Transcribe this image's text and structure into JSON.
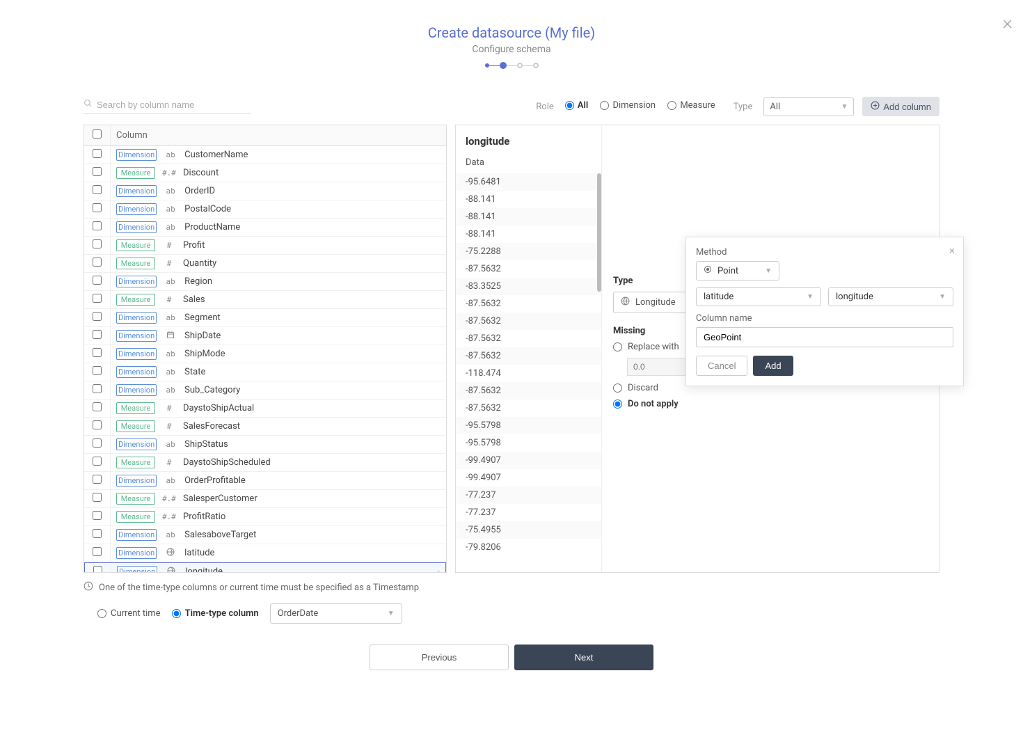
{
  "header": {
    "title": "Create datasource (My file)",
    "subtitle": "Configure schema"
  },
  "toolbar": {
    "search_placeholder": "Search by column name",
    "role_label": "Role",
    "role_options": {
      "all": "All",
      "dimension": "Dimension",
      "measure": "Measure"
    },
    "type_label": "Type",
    "type_value": "All",
    "add_column_label": "Add column"
  },
  "table": {
    "header_label": "Column",
    "columns": [
      {
        "role": "Dimension",
        "type": "ab",
        "name": "CustomerName"
      },
      {
        "role": "Measure",
        "type": "#.#",
        "name": "Discount"
      },
      {
        "role": "Dimension",
        "type": "ab",
        "name": "OrderID"
      },
      {
        "role": "Dimension",
        "type": "ab",
        "name": "PostalCode"
      },
      {
        "role": "Dimension",
        "type": "ab",
        "name": "ProductName"
      },
      {
        "role": "Measure",
        "type": "#",
        "name": "Profit"
      },
      {
        "role": "Measure",
        "type": "#",
        "name": "Quantity"
      },
      {
        "role": "Dimension",
        "type": "ab",
        "name": "Region"
      },
      {
        "role": "Measure",
        "type": "#",
        "name": "Sales"
      },
      {
        "role": "Dimension",
        "type": "ab",
        "name": "Segment"
      },
      {
        "role": "Dimension",
        "type": "cal",
        "name": "ShipDate"
      },
      {
        "role": "Dimension",
        "type": "ab",
        "name": "ShipMode"
      },
      {
        "role": "Dimension",
        "type": "ab",
        "name": "State"
      },
      {
        "role": "Dimension",
        "type": "ab",
        "name": "Sub_Category"
      },
      {
        "role": "Measure",
        "type": "#",
        "name": "DaystoShipActual"
      },
      {
        "role": "Measure",
        "type": "#",
        "name": "SalesForecast"
      },
      {
        "role": "Dimension",
        "type": "ab",
        "name": "ShipStatus"
      },
      {
        "role": "Measure",
        "type": "#",
        "name": "DaystoShipScheduled"
      },
      {
        "role": "Dimension",
        "type": "ab",
        "name": "OrderProfitable"
      },
      {
        "role": "Measure",
        "type": "#.#",
        "name": "SalesperCustomer"
      },
      {
        "role": "Measure",
        "type": "#.#",
        "name": "ProfitRatio"
      },
      {
        "role": "Dimension",
        "type": "ab",
        "name": "SalesaboveTarget"
      },
      {
        "role": "Dimension",
        "type": "geo",
        "name": "latitude"
      },
      {
        "role": "Dimension",
        "type": "geo",
        "name": "longitude",
        "selected": true
      }
    ]
  },
  "detail": {
    "title": "longitude",
    "data_label": "Data",
    "values": [
      "-95.6481",
      "-88.141",
      "-88.141",
      "-88.141",
      "-75.2288",
      "-87.5632",
      "-83.3525",
      "-87.5632",
      "-87.5632",
      "-87.5632",
      "-87.5632",
      "-118.474",
      "-87.5632",
      "-87.5632",
      "-95.5798",
      "-95.5798",
      "-99.4907",
      "-99.4907",
      "-77.237",
      "-77.237",
      "-75.4955",
      "-79.8206"
    ],
    "type_label": "Type",
    "type_value": "Longitude",
    "missing_label": "Missing",
    "missing_options": {
      "replace": "Replace with",
      "replace_placeholder": "0.0",
      "discard": "Discard",
      "donot": "Do not apply"
    }
  },
  "popover": {
    "method_label": "Method",
    "method_value": "Point",
    "field1": "latitude",
    "field2": "longitude",
    "colname_label": "Column name",
    "colname_value": "GeoPoint",
    "cancel": "Cancel",
    "add": "Add"
  },
  "footer": {
    "note": "One of the time-type columns or current time must be specified as a Timestamp",
    "current_time": "Current time",
    "time_col": "Time-type column",
    "time_value": "OrderDate",
    "prev": "Previous",
    "next": "Next"
  }
}
